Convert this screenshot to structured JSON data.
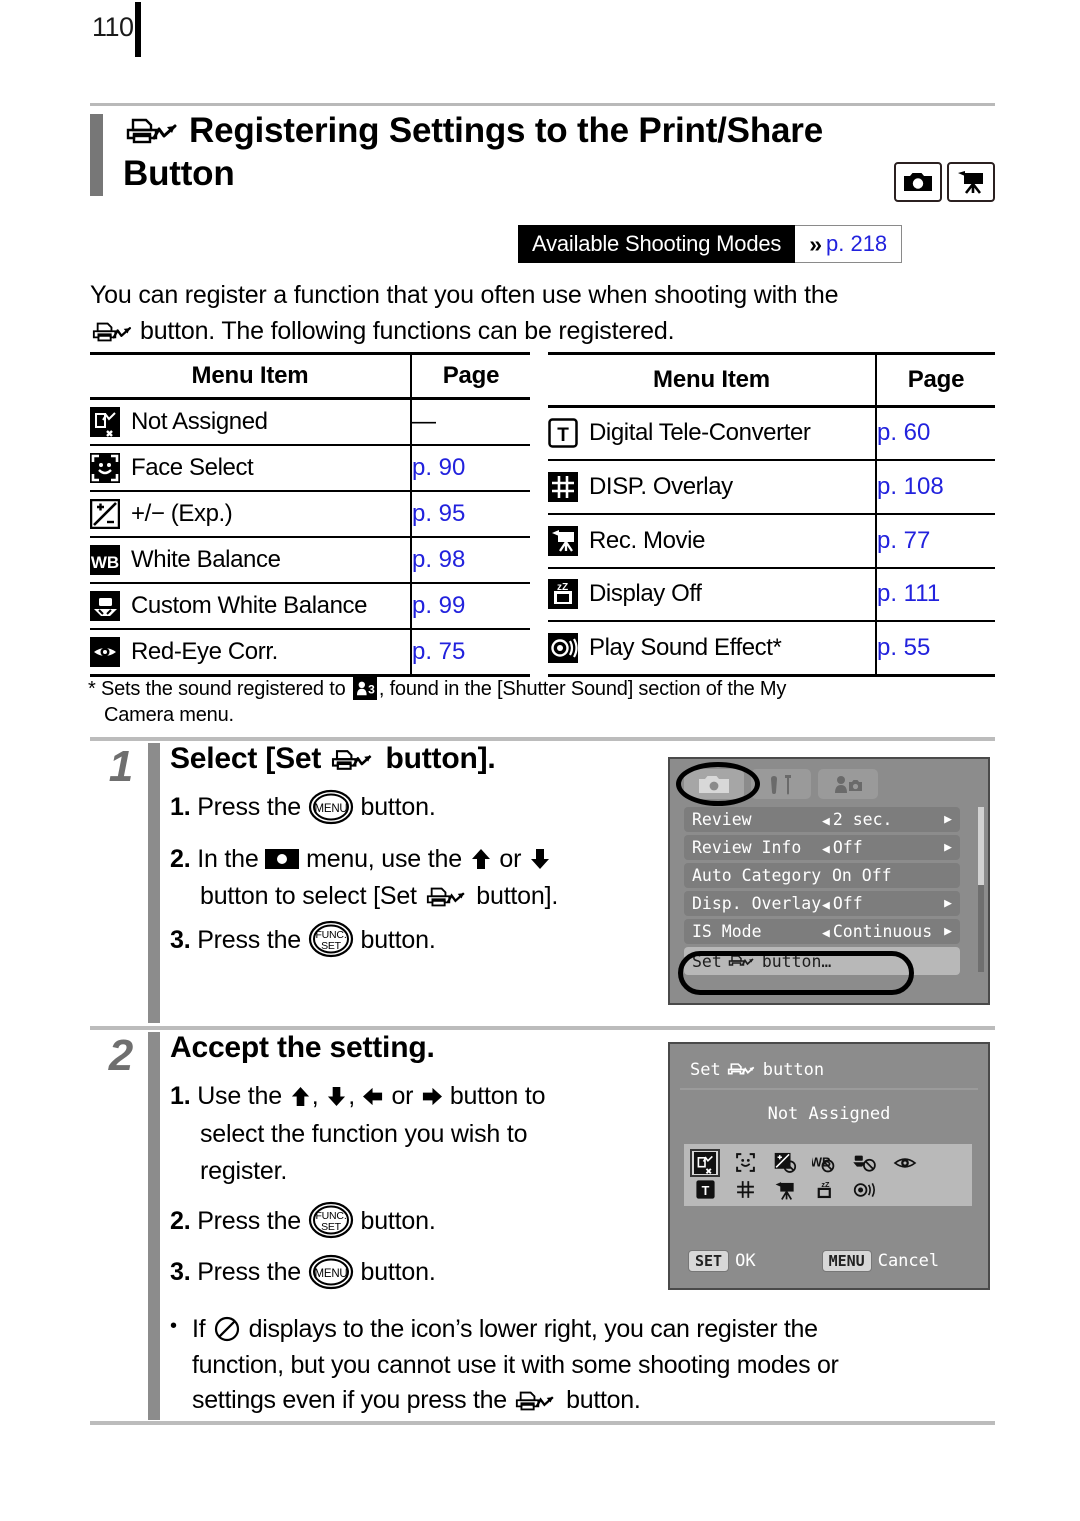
{
  "page": {
    "number": "110"
  },
  "header": {
    "title": "Registering Settings to the Print/Share Button",
    "title_line1": "Registering Settings to the Print/Share",
    "title_line2": "Button",
    "mode_icons": [
      "camera-icon",
      "movie-camera-icon"
    ],
    "print_share_icon": "print-share-icon"
  },
  "available_modes": {
    "label": "Available Shooting Modes",
    "chevron": "»",
    "page_ref": "p. 218"
  },
  "intro": {
    "line1": "You can register a function that you often use when shooting with the",
    "line2_after_icon": "button. The following functions can be registered."
  },
  "tables": {
    "headers": {
      "item": "Menu Item",
      "page": "Page"
    },
    "left_rows": [
      {
        "icon": "not-assigned-icon",
        "label": "Not Assigned",
        "page": "—",
        "is_dash": true
      },
      {
        "icon": "face-select-icon",
        "label": "Face Select",
        "page": "p. 90",
        "is_dash": false
      },
      {
        "icon": "exposure-comp-icon",
        "label": "+/− (Exp.)",
        "page": "p. 95",
        "is_dash": false
      },
      {
        "icon": "white-balance-icon",
        "label": "White Balance",
        "page": "p. 98",
        "is_dash": false
      },
      {
        "icon": "custom-white-balance-icon",
        "label": "Custom White Balance",
        "page": "p. 99",
        "is_dash": false
      },
      {
        "icon": "red-eye-corr-icon",
        "label": "Red-Eye Corr.",
        "page": "p. 75",
        "is_dash": false
      }
    ],
    "right_rows": [
      {
        "icon": "digital-tele-converter-icon",
        "label": "Digital Tele-Converter",
        "page": "p. 60",
        "is_dash": false
      },
      {
        "icon": "disp-overlay-icon",
        "label": "DISP. Overlay",
        "page": "p. 108",
        "is_dash": false
      },
      {
        "icon": "rec-movie-icon",
        "label": "Rec. Movie",
        "page": "p. 77",
        "is_dash": false
      },
      {
        "icon": "display-off-icon",
        "label": "Display Off",
        "page": "p. 111",
        "is_dash": false
      },
      {
        "icon": "play-sound-effect-icon",
        "label": "Play Sound Effect*",
        "page": "p. 55",
        "is_dash": false
      }
    ]
  },
  "footnote": {
    "part1": "* Sets the sound registered to",
    "part2": ", found in the [Shutter Sound] section of the My",
    "part3": "Camera menu."
  },
  "steps": [
    {
      "number": "1",
      "title_pre": "Select [Set",
      "title_post": "button].",
      "items": [
        {
          "num": "1.",
          "pre": "Press the",
          "post": "button.",
          "icon": "menu-button-icon"
        },
        {
          "num": "2.",
          "pre": "In the",
          "mid": "menu, use the",
          "mid2": "or",
          "post": "",
          "line2_pre": "button to select [Set",
          "line2_post": "button]."
        },
        {
          "num": "3.",
          "pre": "Press the",
          "post": "button.",
          "icon": "func-set-button-icon"
        }
      ]
    },
    {
      "number": "2",
      "title": "Accept the setting.",
      "items": [
        {
          "num": "1.",
          "pre": "Use the",
          "post": "button to",
          "line2": "select the function you wish to",
          "line3": "register."
        },
        {
          "num": "2.",
          "pre": "Press the",
          "post": "button.",
          "icon": "func-set-button-icon"
        },
        {
          "num": "3.",
          "pre": "Press the",
          "post": "button.",
          "icon": "menu-button-icon"
        }
      ]
    }
  ],
  "bullet": {
    "pre": "If",
    "line1_post": "displays to the icon’s lower right, you can register the",
    "line2": "function, but you cannot use it with some shooting modes or",
    "line3_pre": "settings even if you press the",
    "line3_post": "button."
  },
  "lcd_menu": {
    "tabs": [
      "camera-tab-icon",
      "wrench-tools-tab-icon",
      "my-camera-tab-icon"
    ],
    "rows": [
      {
        "label": "Review",
        "value": "2 sec.",
        "left_arrow": true,
        "right_arrow": true
      },
      {
        "label": "Review Info",
        "value": "Off",
        "left_arrow": true,
        "right_arrow": true
      },
      {
        "label": "Auto Category",
        "value": "On Off",
        "left_arrow": false,
        "right_arrow": false
      },
      {
        "label": "Disp. Overlay",
        "value": "Off",
        "left_arrow": true,
        "right_arrow": true
      },
      {
        "label": "IS Mode",
        "value": "Continuous",
        "left_arrow": true,
        "right_arrow": true
      }
    ],
    "highlighted_row": {
      "pre": "Set",
      "post": "button…"
    }
  },
  "lcd_setbutton": {
    "title_pre": "Set",
    "title_post": "button",
    "status": "Not Assigned",
    "row1_icons": [
      "not-assigned-icon",
      "face-select-icon",
      "exposure-comp-disabled-icon",
      "white-balance-disabled-icon",
      "custom-white-balance-disabled-icon",
      "red-eye-corr-icon"
    ],
    "row2_icons": [
      "digital-tele-converter-icon",
      "disp-overlay-icon",
      "rec-movie-icon",
      "display-off-icon",
      "play-sound-effect-icon"
    ],
    "set_key": "SET",
    "set_label": "OK",
    "menu_key": "MENU",
    "menu_label": "Cancel"
  },
  "colors": {
    "page_ref_blue": "#2222dd",
    "accent_gray": "#8c8c8c",
    "rule_gray": "#bcbcbc",
    "lcd_bg": "#8c8c8c"
  }
}
